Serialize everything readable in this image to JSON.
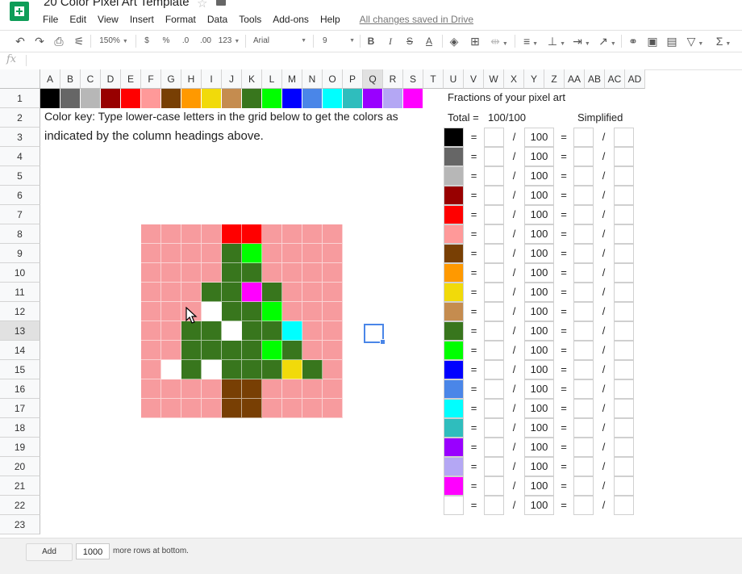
{
  "app": {
    "title": "20 Color Pixel Art Template",
    "menus": [
      "File",
      "Edit",
      "View",
      "Insert",
      "Format",
      "Data",
      "Tools",
      "Add-ons",
      "Help"
    ],
    "saved_status": "All changes saved in Drive"
  },
  "toolbar": {
    "zoom": "150%",
    "currency": "$",
    "percent": "%",
    "decrease_decimals": ".0",
    "increase_decimals": ".00",
    "number_format": "123",
    "font": "Arial",
    "font_size": "9",
    "bold": "B",
    "italic": "I",
    "strike": "S",
    "text_color": "A"
  },
  "formula_bar": {
    "label": "fx",
    "value": ""
  },
  "columns": [
    "A",
    "B",
    "C",
    "D",
    "E",
    "F",
    "G",
    "H",
    "I",
    "J",
    "K",
    "L",
    "M",
    "N",
    "O",
    "P",
    "Q",
    "R",
    "S",
    "T",
    "U",
    "V",
    "W",
    "X",
    "Y",
    "Z",
    "AA",
    "AB",
    "AC",
    "AD"
  ],
  "rows": [
    "1",
    "2",
    "3",
    "4",
    "5",
    "6",
    "7",
    "8",
    "9",
    "10",
    "11",
    "12",
    "13",
    "14",
    "15",
    "16",
    "17",
    "18",
    "19",
    "20",
    "21",
    "22",
    "23"
  ],
  "selected_column": "Q",
  "selected_row": "13",
  "palette": [
    "#000000",
    "#666666",
    "#b7b7b7",
    "#980000",
    "#ff0000",
    "#ff9999",
    "#783f04",
    "#ff9900",
    "#f1da0a",
    "#c58c4f",
    "#38761d",
    "#00ff00",
    "#0000ff",
    "#4a86e8",
    "#00ffff",
    "#2fbdbd",
    "#9900ff",
    "#b4a7f4",
    "#ff00ff",
    "#ffffff"
  ],
  "colors": {
    "pink": "#f79b9e",
    "red": "#ff0000",
    "green": "#38761d",
    "lime": "#00ff00",
    "magenta": "#ff00ff",
    "cyan": "#00ffff",
    "yellow": "#f1da0a",
    "brown": "#783f04",
    "white": "#ffffff",
    "selection": "#4a86e8"
  },
  "color_key": {
    "line1": "Color key: Type lower-case letters in the grid below to get the colors as",
    "line2": "indicated by the column headings above."
  },
  "pixel_art": [
    "PPPPRRPPPP",
    "PPPPGLPPPP",
    "PPPPGGPPPP",
    "PPPGGMGPPP",
    "PPPWGGLPPP",
    "PPGGWGGCPP",
    "PPGGGGLGPP",
    "PWGWGGGYGP",
    "PPPPBBPPPP",
    "PPPPBBPPPP"
  ],
  "fractions": {
    "title": "Fractions of your pixel art",
    "total_label": "Total =",
    "total_value": "100/100",
    "simplified_label": "Simplified",
    "equals": "=",
    "slash": "/",
    "denominator": "100"
  },
  "footer": {
    "add_label": "Add",
    "rows_value": "1000",
    "more_rows_label": "more rows at bottom."
  }
}
